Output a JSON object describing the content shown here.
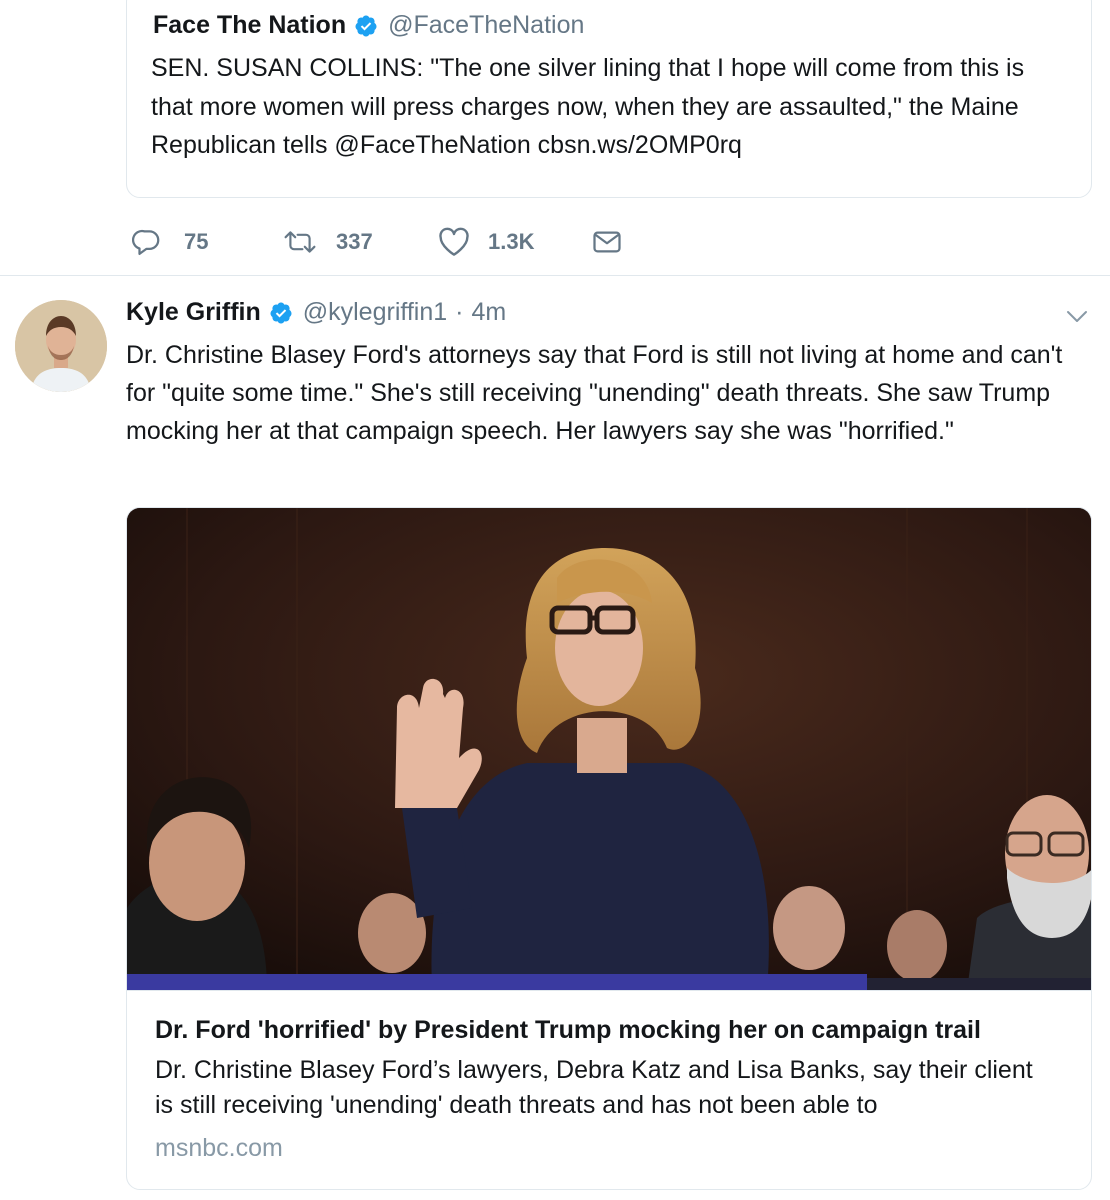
{
  "quoted_tweet": {
    "name": "Face The Nation",
    "handle": "@FaceTheNation",
    "text": "SEN. SUSAN COLLINS: \"The one silver lining that I hope will come from this is that more women will press charges now, when they are assaulted,\" the Maine Republican tells @FaceTheNation cbsn.ws/2OMP0rq"
  },
  "actions": {
    "reply_count": "75",
    "retweet_count": "337",
    "like_count": "1.3K"
  },
  "tweet": {
    "name": "Kyle Griffin",
    "handle": "@kylegriffin1",
    "separator": "·",
    "time": "4m",
    "text": "Dr. Christine Blasey Ford's attorneys say that Ford is still not living at home and can't for \"quite some time.\" She's still receiving \"unending\" death threats. She saw Trump mocking her at that campaign speech. Her lawyers say she was \"horrified.\""
  },
  "link_card": {
    "title": "Dr. Ford 'horrified' by President Trump mocking her on campaign trail",
    "description": "Dr. Christine Blasey Ford’s lawyers, Debra Katz and Lisa Banks, say their client is still receiving 'unending' death threats and has not been able to",
    "domain": "msnbc.com"
  },
  "colors": {
    "verified_blue": "#1da1f2",
    "secondary_text": "#657786",
    "border": "#e1e8ed",
    "domain_text": "#8899a6"
  },
  "icons": [
    "verified-badge-icon",
    "reply-icon",
    "retweet-icon",
    "like-icon",
    "direct-message-icon",
    "chevron-down-icon"
  ]
}
